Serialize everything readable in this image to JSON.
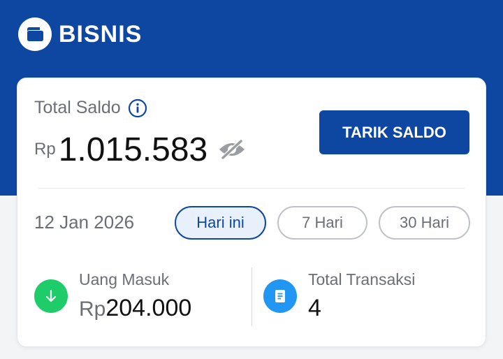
{
  "brand": {
    "name": "BISNIS",
    "icon": "wallet-icon"
  },
  "balance": {
    "label": "Total Saldo",
    "currency": "Rp",
    "amount": "1.015.583",
    "info_icon": "info-icon",
    "toggle_icon": "eye-off-icon"
  },
  "withdraw_button": {
    "label": "TARIK SALDO"
  },
  "date": "12 Jan 2026",
  "filters": [
    {
      "label": "Hari ini",
      "active": true
    },
    {
      "label": "7 Hari",
      "active": false
    },
    {
      "label": "30 Hari",
      "active": false
    }
  ],
  "stats": {
    "income": {
      "label": "Uang Masuk",
      "currency": "Rp",
      "value": "204.000",
      "icon": "arrow-down-icon"
    },
    "transactions": {
      "label": "Total Transaksi",
      "value": "4",
      "icon": "receipt-icon"
    }
  },
  "colors": {
    "primary": "#0d47a1",
    "income_icon_bg": "#1fcc6a",
    "transactions_icon_bg": "#2196f3"
  }
}
